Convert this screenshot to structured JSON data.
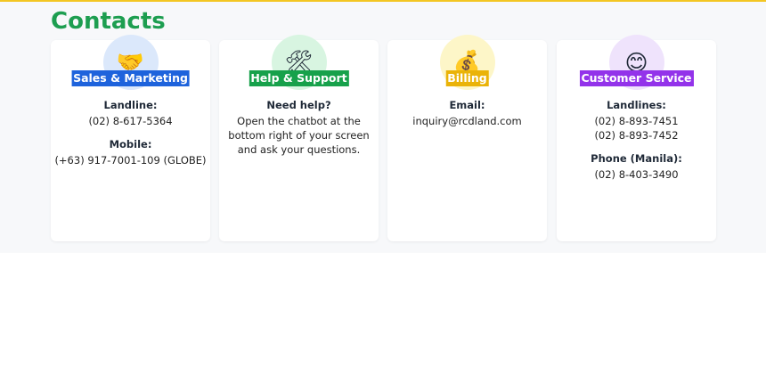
{
  "page": {
    "title": "Contacts"
  },
  "cards": [
    {
      "heading": "Sales & Marketing",
      "icon": "handshake-icon",
      "icon_glyph": "🤝",
      "badge_color": "#1e63dc",
      "circle_color": "#dbe8fb",
      "groups": [
        {
          "label": "Landline:",
          "values": [
            "(02) 8-617-5364"
          ]
        },
        {
          "label": "Mobile:",
          "values": [
            "(+63) 917-7001-109 (GLOBE)"
          ]
        }
      ]
    },
    {
      "heading": "Help & Support",
      "icon": "tools-icon",
      "icon_glyph": "🛠",
      "badge_color": "#17a14b",
      "circle_color": "#d8f5e1",
      "groups": [
        {
          "label": "Need help?",
          "values": [
            "Open the chatbot at the",
            "bottom right of your screen",
            "and ask your questions."
          ]
        }
      ]
    },
    {
      "heading": "Billing",
      "icon": "money-bag-icon",
      "icon_glyph": "💰",
      "badge_color": "#eab308",
      "circle_color": "#fdf6c8",
      "groups": [
        {
          "label": "Email:",
          "values": [
            "inquiry@rcdland.com"
          ]
        }
      ]
    },
    {
      "heading": "Customer Service",
      "icon": "smiling-face-icon",
      "icon_glyph": "😊",
      "badge_color": "#9333ea",
      "circle_color": "#efe3fc",
      "groups": [
        {
          "label": "Landlines:",
          "values": [
            "(02) 8-893-7451",
            "(02) 8-893-7452"
          ]
        },
        {
          "label": "Phone (Manila):",
          "values": [
            "(02) 8-403-3490"
          ]
        }
      ]
    }
  ]
}
